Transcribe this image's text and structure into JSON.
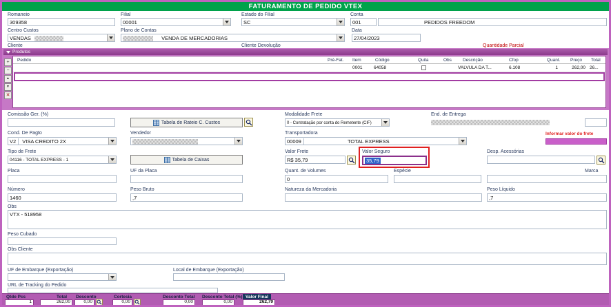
{
  "title": "FATURAMENTO DE PEDIDO VTEX",
  "header": {
    "romaneio": {
      "label": "Romaneio",
      "value": "309358"
    },
    "filial": {
      "label": "Filial",
      "value": "00001"
    },
    "estado_filial": {
      "label": "Estado do Filial",
      "value": "SC"
    },
    "conta": {
      "label": "Conta",
      "code": "001",
      "name": "PEDIDOS FREEDOM"
    },
    "centro_custos": {
      "label": "Centro Custos",
      "value": "VENDAS"
    },
    "plano_contas": {
      "label": "Plano de Contas",
      "value": "VENDA DE MERCADORIAS"
    },
    "data": {
      "label": "Data",
      "value": "27/04/2023"
    },
    "cliente_label": "Cliente",
    "cliente_devolucao_label": "Cliente Devolução",
    "quantidade_parcial_label": "Quantidade Parcial"
  },
  "produtos": {
    "title": "Produtos",
    "nav": {
      "add": "+",
      "remove": "−",
      "up": "▲",
      "down": "▼",
      "delete": "✕"
    },
    "columns": {
      "pedido": "Pedido",
      "pre_fat": "Pré-Fat.",
      "item": "Item",
      "codigo": "Código",
      "quita": "Quita",
      "obs": "Obs",
      "descricao": "Descrição",
      "cfop": "Cfop",
      "quant": "Quant.",
      "preco": "Preço",
      "total": "Total"
    },
    "row": {
      "item": "0001",
      "codigo": "64058",
      "descricao": "VALVULA DA T...",
      "cfop": "6.108",
      "quant": "1",
      "preco": "262,00",
      "total": "26..."
    }
  },
  "form": {
    "comissao": {
      "label": "Comissão Ger. (%)",
      "value": ""
    },
    "tabela_rateio_button": "Tabela de Rateio C. Custos",
    "modalidade_frete": {
      "label": "Modalidade Frete",
      "value": "0 - Contratação por conta do Remetente (CIF)"
    },
    "end_entrega": {
      "label": "End. de Entrega"
    },
    "cond_pagto": {
      "label": "Cond. De Pagto",
      "code": "V2",
      "name": "VISA CREDITO 2X"
    },
    "vendedor": {
      "label": "Vendedor"
    },
    "transportadora": {
      "label": "Transportadora",
      "code": "00009",
      "name": "TOTAL EXPRESS"
    },
    "informar_frete": "Informar valor do frete",
    "tipo_frete": {
      "label": "Tipo de Frete",
      "value": "04116 - TOTAL EXPRESS - 1"
    },
    "tabela_caixas_button": "Tabela de Caixas",
    "valor_frete": {
      "label": "Valor Frete",
      "value": "R$ 35,79"
    },
    "valor_seguro": {
      "label": "Valor Seguro",
      "value": "35,79"
    },
    "desp_acessorias": {
      "label": "Desp. Acessórias",
      "value": ""
    },
    "placa": {
      "label": "Placa",
      "value": ""
    },
    "uf_placa": {
      "label": "UF da Placa",
      "value": ""
    },
    "quant_volumes": {
      "label": "Quant. de Volumes",
      "value": "0"
    },
    "especie": {
      "label": "Espécie",
      "value": ""
    },
    "marca": {
      "label": "Marca",
      "value": ""
    },
    "numero": {
      "label": "Número",
      "value": "1460"
    },
    "peso_bruto": {
      "label": "Peso Bruto",
      "value": ",7"
    },
    "natureza": {
      "label": "Natureza da Mercadoria",
      "value": ""
    },
    "peso_liquido": {
      "label": "Peso Líquido",
      "value": ",7"
    },
    "obs": {
      "label": "Obs",
      "value": "VTX - 518958"
    },
    "peso_cubado": {
      "label": "Peso Cubado",
      "value": ""
    },
    "obs_cliente": {
      "label": "Obs Cliente",
      "value": ""
    },
    "uf_embarque": {
      "label": "UF de Embarque (Exportação)",
      "value": ""
    },
    "local_embarque": {
      "label": "Local de Embarque (Exportação)",
      "value": ""
    },
    "url_tracking": {
      "label": "URL de Tracking do Pedido",
      "value": ""
    }
  },
  "footer": {
    "qtde_pcs": {
      "label": "Qtde Pcs",
      "value": "1"
    },
    "total": {
      "label": "Total",
      "value": "262,00"
    },
    "desconto": {
      "label": "Desconto",
      "value": "0,00"
    },
    "cortesia": {
      "label": "Cortesia",
      "value": "0,00"
    },
    "desconto_total": {
      "label": "Desconto Total",
      "value": "0,00"
    },
    "desconto_total_pct": {
      "label": "Desconto Total (%)",
      "value": "0,00"
    },
    "valor_final": {
      "label": "Valor Final",
      "value": "262,79"
    }
  }
}
